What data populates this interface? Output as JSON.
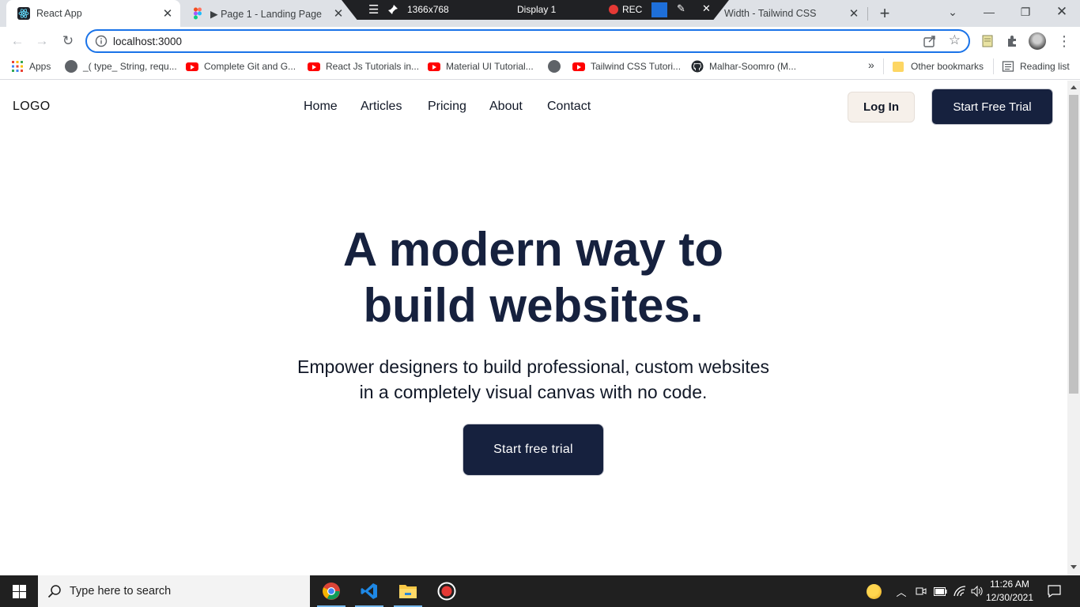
{
  "browser": {
    "tabs": [
      {
        "title": "React App",
        "active": true
      },
      {
        "title": "▶ Page 1 - Landing Page",
        "active": false
      },
      {
        "title": "Width - Tailwind CSS",
        "active": false
      }
    ],
    "recorder": {
      "resolution": "1366x768",
      "display": "Display 1",
      "rec_label": "REC"
    },
    "address_bar": {
      "url": "localhost:3000"
    },
    "bookmarks": [
      {
        "label": "Apps",
        "icon": "apps-grid-icon"
      },
      {
        "label": "_( type_ String, requ...",
        "icon": "globe-icon"
      },
      {
        "label": "Complete Git and G...",
        "icon": "youtube-icon"
      },
      {
        "label": "React Js Tutorials in...",
        "icon": "youtube-icon"
      },
      {
        "label": "Material UI Tutorial...",
        "icon": "youtube-icon"
      },
      {
        "label": "",
        "icon": "globe-icon"
      },
      {
        "label": "Tailwind CSS Tutori...",
        "icon": "youtube-icon"
      },
      {
        "label": "Malhar-Soomro (M...",
        "icon": "github-icon"
      }
    ],
    "bookmarks_overflow": "»",
    "other_bookmarks": "Other bookmarks",
    "reading_list": "Reading list"
  },
  "site": {
    "logo": "LOGO",
    "nav": [
      "Home",
      "Articles",
      "Pricing",
      "About",
      "Contact"
    ],
    "login_label": "Log In",
    "trial_label": "Start Free Trial",
    "hero_title_line1": "A modern way to",
    "hero_title_line2": "build websites.",
    "hero_sub_line1": "Empower designers to build professional, custom websites",
    "hero_sub_line2": "in a completely visual canvas with no code.",
    "hero_cta": "Start free trial",
    "colors": {
      "navy": "#16213e",
      "login_bg": "#f6f0ea"
    }
  },
  "taskbar": {
    "search_placeholder": "Type here to search",
    "apps": [
      "chrome-icon",
      "vscode-icon",
      "file-explorer-icon",
      "recorder-icon"
    ],
    "time": "11:26 AM",
    "date": "12/30/2021"
  }
}
